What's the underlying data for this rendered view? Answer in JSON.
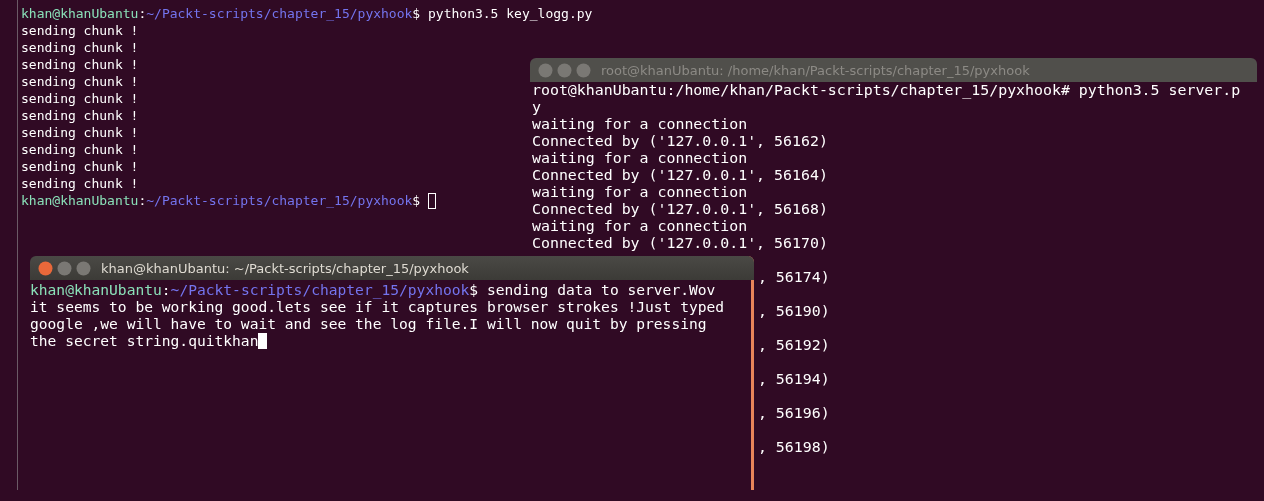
{
  "windows": [
    {
      "focused": false,
      "cursor": true,
      "lines": [
        {
          "kind": "prompt",
          "user": "khan@khanUbantu",
          "separator": ":",
          "path": "~/Packt-scripts/chapter_15/pyxhook",
          "command": "$ python3.5 key_logg.py"
        },
        {
          "kind": "output",
          "text": "sending chunk !"
        },
        {
          "kind": "output",
          "text": "sending chunk !"
        },
        {
          "kind": "output",
          "text": "sending chunk !"
        },
        {
          "kind": "output",
          "text": "sending chunk !"
        },
        {
          "kind": "output",
          "text": "sending chunk !"
        },
        {
          "kind": "output",
          "text": "sending chunk !"
        },
        {
          "kind": "output",
          "text": "sending chunk !"
        },
        {
          "kind": "output",
          "text": "sending chunk !"
        },
        {
          "kind": "output",
          "text": "sending chunk !"
        },
        {
          "kind": "output",
          "text": "sending chunk !"
        },
        {
          "kind": "prompt",
          "user": "khan@khanUbantu",
          "separator": ":",
          "path": "~/Packt-scripts/chapter_15/pyxhook",
          "command": "$"
        }
      ]
    },
    {
      "title": "root@khanUbantu: /home/khan/Packt-scripts/chapter_15/pyxhook",
      "focused": false,
      "cursor": false,
      "lines": [
        {
          "kind": "output",
          "text": "root@khanUbantu:/home/khan/Packt-scripts/chapter_15/pyxhook# python3.5 server.p"
        },
        {
          "kind": "output",
          "text": "y"
        },
        {
          "kind": "output",
          "text": "waiting for a connection"
        },
        {
          "kind": "output",
          "text": "Connected by ('127.0.0.1', 56162)"
        },
        {
          "kind": "output",
          "text": "waiting for a connection"
        },
        {
          "kind": "output",
          "text": "Connected by ('127.0.0.1', 56164)"
        },
        {
          "kind": "output",
          "text": "waiting for a connection"
        },
        {
          "kind": "output",
          "text": "Connected by ('127.0.0.1', 56168)"
        },
        {
          "kind": "output",
          "text": "waiting for a connection"
        },
        {
          "kind": "output",
          "text": "Connected by ('127.0.0.1', 56170)"
        },
        {
          "kind": "tail",
          "text": ", 56174)"
        },
        {
          "kind": "tail",
          "text": ", 56190)"
        },
        {
          "kind": "tail",
          "text": ", 56192)"
        },
        {
          "kind": "tail",
          "text": ", 56194)"
        },
        {
          "kind": "tail",
          "text": ", 56196)"
        },
        {
          "kind": "tail",
          "text": ", 56198)"
        }
      ]
    },
    {
      "title": "khan@khanUbantu: ~/Packt-scripts/chapter_15/pyxhook",
      "focused": true,
      "cursor": true,
      "lines": [
        {
          "kind": "prompt",
          "user": "khan@khanUbantu",
          "separator": ":",
          "path": "~/Packt-scripts/chapter_15/pyxhook",
          "command": "$ sending data to server.Wov"
        },
        {
          "kind": "output",
          "text": "it seems to be working good.lets see if it captures browser strokes !Just typed"
        },
        {
          "kind": "output",
          "text": "google ,we will have to wait and see the log file.I will now quit by pressing"
        },
        {
          "kind": "output",
          "text": "the secret string.quitkhan"
        }
      ]
    }
  ]
}
